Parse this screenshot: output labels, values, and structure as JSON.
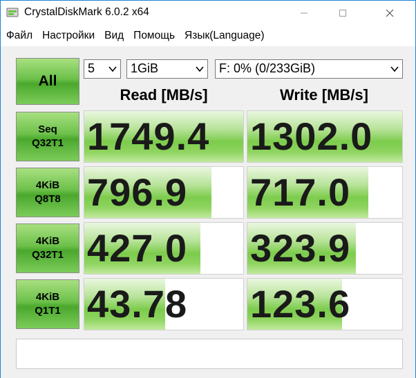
{
  "window": {
    "title": "CrystalDiskMark 6.0.2 x64"
  },
  "menu": [
    "Файл",
    "Настройки",
    "Вид",
    "Помощь",
    "Язык(Language)"
  ],
  "controls": {
    "all_label": "All",
    "count_value": "5",
    "size_value": "1GiB",
    "drive_value": "F: 0% (0/233GiB)"
  },
  "headers": {
    "read": "Read [MB/s]",
    "write": "Write [MB/s]"
  },
  "rows": [
    {
      "line1": "Seq",
      "line2": "Q32T1",
      "read": "1749.4",
      "write": "1302.0",
      "read_fill": 1.0,
      "write_fill": 1.0
    },
    {
      "line1": "4KiB",
      "line2": "Q8T8",
      "read": "796.9",
      "write": "717.0",
      "read_fill": 0.8,
      "write_fill": 0.78
    },
    {
      "line1": "4KiB",
      "line2": "Q32T1",
      "read": "427.0",
      "write": "323.9",
      "read_fill": 0.73,
      "write_fill": 0.7
    },
    {
      "line1": "4KiB",
      "line2": "Q1T1",
      "read": "43.78",
      "write": "123.6",
      "read_fill": 0.51,
      "write_fill": 0.61
    }
  ],
  "status": {
    "text": ""
  },
  "icons": {
    "app": "crystaldiskmark-icon",
    "minimize": "minimize-icon",
    "maximize": "maximize-icon",
    "close": "close-icon",
    "dropdown": "chevron-down-icon"
  }
}
